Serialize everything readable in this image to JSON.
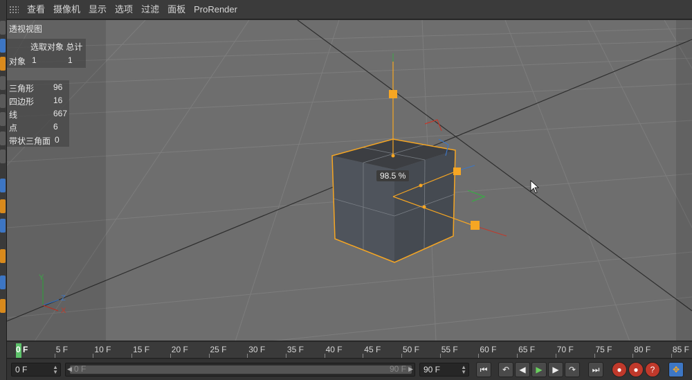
{
  "menubar": {
    "items": [
      "查看",
      "摄像机",
      "显示",
      "选项",
      "过滤",
      "面板",
      "ProRender"
    ]
  },
  "viewport": {
    "view_name": "透视视图",
    "stats_header": "选取对象 总计",
    "objects_label": "对象",
    "objects_selected": "1",
    "objects_total": "1",
    "mesh_stats": [
      {
        "label": "三角形",
        "value": "96"
      },
      {
        "label": "四边形",
        "value": "16"
      },
      {
        "label": "线",
        "value": "667"
      },
      {
        "label": "点",
        "value": "6"
      },
      {
        "label": "带状三角面",
        "value": "0"
      }
    ],
    "zoom_tooltip": "98.5 %",
    "axis_labels": {
      "x": "X",
      "y": "Y",
      "z": "Z"
    }
  },
  "timeline": {
    "current_label": "0 F",
    "ticks": [
      "5 F",
      "10 F",
      "15 F",
      "20 F",
      "25 F",
      "30 F",
      "35 F",
      "40 F",
      "45 F",
      "50 F",
      "55 F",
      "60 F",
      "65 F",
      "70 F",
      "75 F",
      "80 F",
      "85 F"
    ]
  },
  "transport": {
    "current_frame": "0 F",
    "range_start": "0 F",
    "range_end": "90 F",
    "end_frame": "90 F"
  },
  "colors": {
    "accent_orange": "#f6a623",
    "play_green": "#5ec36b",
    "record_red": "#c0392b"
  }
}
